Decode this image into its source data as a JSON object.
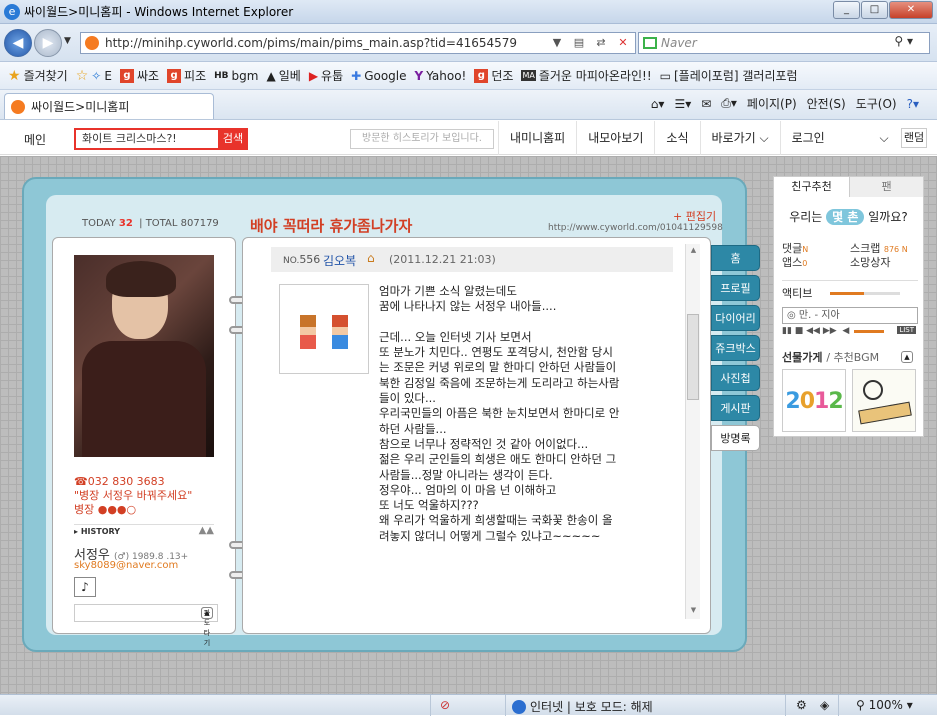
{
  "window": {
    "title": "싸이월드>미니홈피 - Windows Internet Explorer"
  },
  "address": {
    "url": "http://minihp.cyworld.com/pims/main/pims_main.asp?tid=41654579",
    "search_placeholder": "Naver"
  },
  "favorites": [
    {
      "label": "즐겨찾기",
      "icon": "star-icon"
    },
    {
      "label": "E",
      "icon": "ie-favicon"
    },
    {
      "label": "싸조",
      "icon": "g-favicon"
    },
    {
      "label": "피조",
      "icon": "g-favicon"
    },
    {
      "label": "bgm",
      "icon": "hb-favicon"
    },
    {
      "label": "일베",
      "icon": "arrow-icon"
    },
    {
      "label": "유툽",
      "icon": "youtube-icon"
    },
    {
      "label": "Google",
      "icon": "google-icon"
    },
    {
      "label": "Yahoo!",
      "icon": "yahoo-icon"
    },
    {
      "label": "던조",
      "icon": "g-favicon"
    },
    {
      "label": "즐거운 마피아온라인!!",
      "icon": "ma-favicon"
    },
    {
      "label": "[플레이포럼] 갤러리포럼",
      "icon": "page-icon"
    }
  ],
  "tab": {
    "label": "싸이월드>미니홈피"
  },
  "commands": [
    "페이지(P)",
    "안전(S)",
    "도구(O)"
  ],
  "cynav": {
    "main": "메인",
    "search_value": "화이트 크리스마스?!",
    "search_button": "검색",
    "history_placeholder": "방문한 히스토리가 보입니다.",
    "menu": [
      "내미니홈피",
      "내모아보기",
      "소식",
      "바로가기",
      "로그인"
    ],
    "random": "랜덤"
  },
  "home": {
    "today_label": "TODAY",
    "today": "32",
    "total_label": "TOTAL",
    "total": "807179",
    "title": "배야 꼭떠라 휴가좀나가자",
    "edit": "+ 편집기",
    "url": "http://www.cyworld.com/01041129598",
    "phone": "☎032 830 3683",
    "status_line1": "\"병장 서정우 바꿔주세요\"",
    "status_line2": "병장 ●●●○",
    "history_label": "HISTORY",
    "name": "서정우",
    "name_meta": "(♂) 1989.8 .13+",
    "email": "sky8089@naver.com",
    "music_icon": "♪",
    "padotagi": "파도타기"
  },
  "post": {
    "no_label": "NO.",
    "no": "556",
    "author": "김오복",
    "date": "(2011.12.21 21:03)",
    "body": "엄마가 기쁜 소식 알렸는데도\n꿈에 나타나지 않는 서정우 내아들....\n\n근데... 오늘 인터넷 기사 보면서\n또 분노가 치민다.. 연평도 포격당시, 천안함 당시\n는 조문은 커녕 위로의 말 한마디 안하던 사람들이\n북한 김정일 죽음에 조문하는게 도리라고 하는사람\n들이 있다...\n우리국민들의 아픔은 북한 눈치보면서 한마디로 안\n하던 사람들...\n참으로 너무나 정략적인 것 같아 어이없다...\n젊은 우리 군인들의 희생은 애도 한마디 안하던 그\n사람들...정말 아니라는 생각이 든다.\n정우야... 엄마의 이 마음 넌 이해하고\n또 너도 억울하지???\n왜 우리가 억울하게 희생할때는 국화꽃 한송이 올\n려놓지 않더니 어떻게 그럴수 있냐고~~~~~"
  },
  "side_tabs": [
    "홈",
    "프로필",
    "다이어리",
    "쥬크박스",
    "사진첩",
    "게시판",
    "방명록"
  ],
  "right_col": {
    "tab1": "친구추천",
    "tab2": "팬",
    "chon_pre": "우리는",
    "chon": "몇 촌",
    "chon_post": "일까요?",
    "stats": [
      {
        "label": "댓글",
        "badge": "N"
      },
      {
        "label": "스크랩",
        "badge": "876 N"
      },
      {
        "label": "앱스",
        "badge": "0"
      },
      {
        "label": "소망상자",
        "badge": ""
      }
    ],
    "active_label": "액티브",
    "player": "만. - 지아",
    "player_list": "LIST",
    "gift_title": "선물가게",
    "gift_sub": "/ 추천BGM",
    "gift_img_text": "2012"
  },
  "statusbar": {
    "zone": "인터넷 | 보호 모드: 해제",
    "zoom": "100%"
  }
}
